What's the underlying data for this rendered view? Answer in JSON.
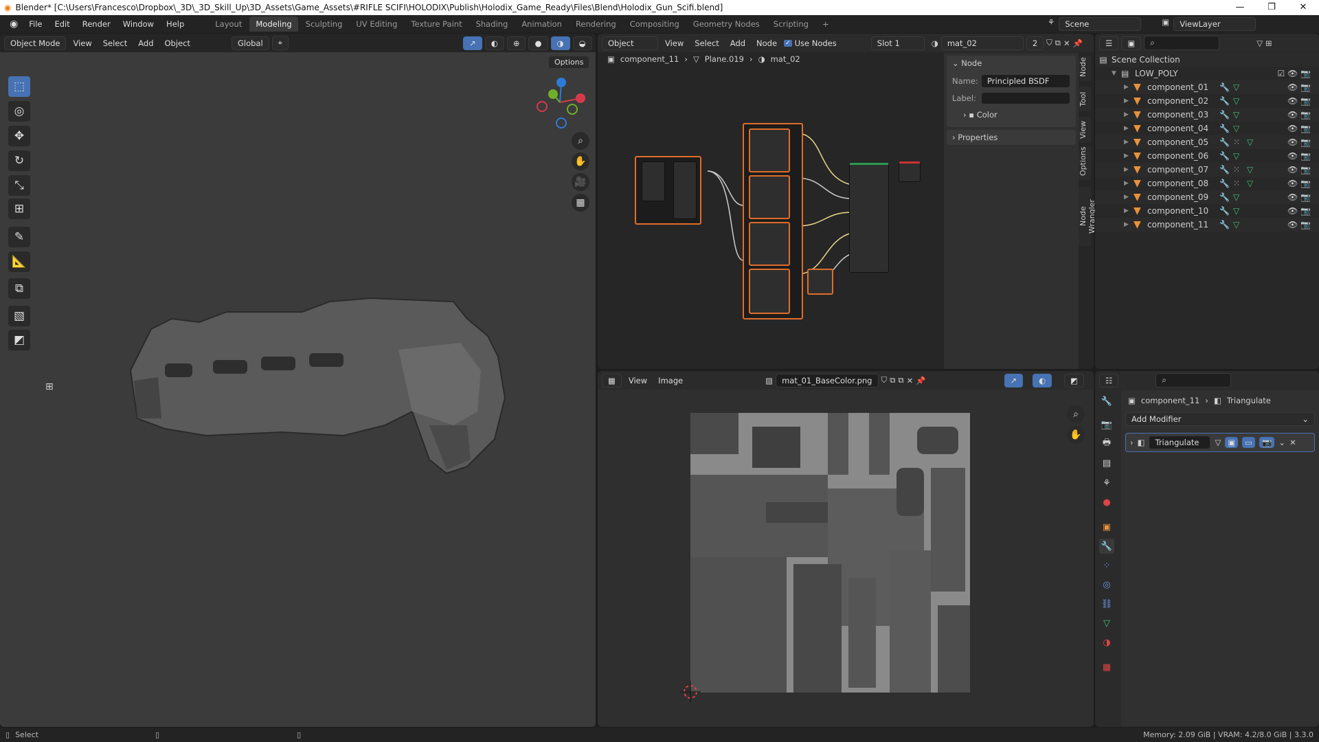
{
  "titlebar": {
    "title": "Blender* [C:\\Users\\Francesco\\Dropbox\\_3D\\_3D_Skill_Up\\3D_Assets\\Game_Assets\\#RIFLE SCIFI\\HOLODIX\\Publish\\Holodix_Game_Ready\\Files\\Blend\\Holodix_Gun_Scifi.blend]",
    "minimize": "—",
    "maximize": "❐",
    "close": "✕"
  },
  "menu": [
    "File",
    "Edit",
    "Render",
    "Window",
    "Help"
  ],
  "workspaces": [
    "Layout",
    "Modeling",
    "Sculpting",
    "UV Editing",
    "Texture Paint",
    "Shading",
    "Animation",
    "Rendering",
    "Compositing",
    "Geometry Nodes",
    "Scripting",
    "+"
  ],
  "active_workspace": "Modeling",
  "scene": {
    "scene": "Scene",
    "view_layer": "ViewLayer"
  },
  "viewport": {
    "mode": "Object Mode",
    "menus": [
      "View",
      "Select",
      "Add",
      "Object"
    ],
    "transform": "Global",
    "options": "Options"
  },
  "node_editor": {
    "type": "Object",
    "menus": [
      "View",
      "Select",
      "Add",
      "Node"
    ],
    "use_nodes": "Use Nodes",
    "slot": "Slot 1",
    "material": "mat_02",
    "users": "2",
    "breadcrumb": [
      "component_11",
      "Plane.019",
      "mat_02"
    ],
    "panel": {
      "title": "Node",
      "name_label": "Name:",
      "name_value": "Principled BSDF",
      "label_label": "Label:",
      "color": "Color",
      "properties": "Properties"
    },
    "tabs": [
      "Node",
      "Tool",
      "View",
      "Options",
      "Node Wrangler"
    ]
  },
  "outliner": {
    "root": "Scene Collection",
    "collection": "LOW_POLY",
    "items": [
      {
        "name": "component_01",
        "extra": false
      },
      {
        "name": "component_02",
        "extra": false
      },
      {
        "name": "component_03",
        "extra": false
      },
      {
        "name": "component_04",
        "extra": false
      },
      {
        "name": "component_05",
        "extra": true
      },
      {
        "name": "component_06",
        "extra": false
      },
      {
        "name": "component_07",
        "extra": true
      },
      {
        "name": "component_08",
        "extra": true
      },
      {
        "name": "component_09",
        "extra": false
      },
      {
        "name": "component_10",
        "extra": false
      },
      {
        "name": "component_11",
        "extra": false
      }
    ]
  },
  "image_editor": {
    "menus": [
      "View",
      "Image"
    ],
    "image": "mat_01_BaseColor.png"
  },
  "properties": {
    "breadcrumb": [
      "component_11",
      "Triangulate"
    ],
    "add_modifier": "Add Modifier",
    "modifier": "Triangulate"
  },
  "status": {
    "left": "Select",
    "right": "Memory: 2.09 GiB | VRAM: 4.2/8.0 GiB | 3.3.0"
  },
  "colors": {
    "accent": "#4772b3",
    "selected_node": "#e06d2b",
    "mesh": "#e8923c"
  }
}
